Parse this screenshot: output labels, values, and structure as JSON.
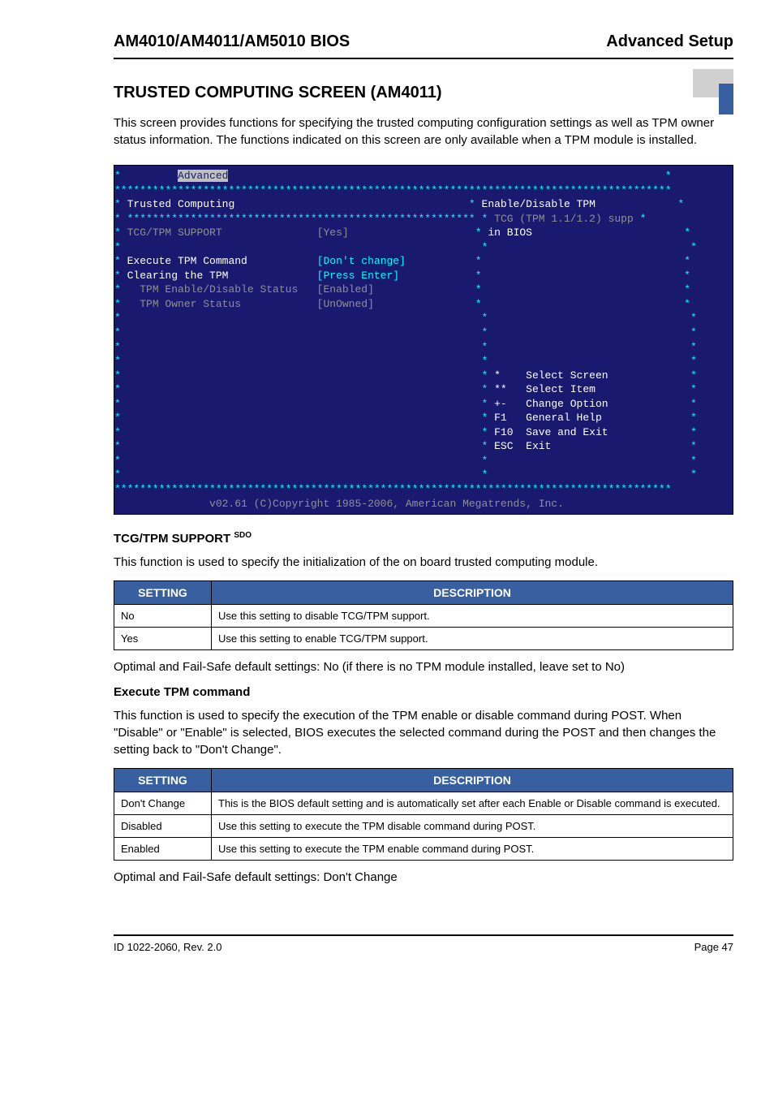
{
  "header": {
    "left": "AM4010/AM4011/AM5010 BIOS",
    "right": "Advanced Setup"
  },
  "section_title": "TRUSTED COMPUTING SCREEN (AM4011)",
  "intro": "This screen provides functions for specifying the trusted computing configuration settings as well as TPM owner status information. The functions indicated on this screen are only available when a TPM module is installed.",
  "bios": {
    "tab": "Advanced",
    "title": "Trusted Computing",
    "items": [
      {
        "label": "TCG/TPM SUPPORT",
        "value": "[Yes]"
      },
      {
        "label": "Execute TPM Command",
        "value": "[Don't change]"
      },
      {
        "label": "Clearing the TPM",
        "value": "[Press Enter]"
      },
      {
        "label": "TPM Enable/Disable Status",
        "value": "[Enabled]"
      },
      {
        "label": "TPM Owner Status",
        "value": "[UnOwned]"
      }
    ],
    "help": [
      "Enable/Disable TPM",
      "TCG (TPM 1.1/1.2) supp",
      "in BIOS"
    ],
    "nav": [
      {
        "key": "*",
        "label": "Select Screen"
      },
      {
        "key": "**",
        "label": "Select Item"
      },
      {
        "key": "+-",
        "label": "Change Option"
      },
      {
        "key": "F1",
        "label": "General Help"
      },
      {
        "key": "F10",
        "label": "Save and Exit"
      },
      {
        "key": "ESC",
        "label": "Exit"
      }
    ],
    "copyright": "v02.61 (C)Copyright 1985-2006, American Megatrends, Inc."
  },
  "tcg_section": {
    "heading": "TCG/TPM SUPPORT",
    "sdo": "SDO",
    "desc": "This function is used to specify the initialization of the on board trusted computing module.",
    "table_headers": {
      "setting": "SETTING",
      "description": "DESCRIPTION"
    },
    "rows": [
      {
        "setting": "No",
        "desc": "Use this setting to disable TCG/TPM support."
      },
      {
        "setting": "Yes",
        "desc": "Use this setting to enable TCG/TPM support."
      }
    ],
    "footnote": "Optimal and Fail-Safe default settings: No (if there is no TPM module installed, leave set to No)"
  },
  "exec_section": {
    "heading": "Execute TPM command",
    "desc": "This function is used to specify the execution of the TPM enable or disable command during POST. When \"Disable\" or \"Enable\" is selected, BIOS executes the selected command during the POST and then changes the setting back to \"Don't Change\".",
    "table_headers": {
      "setting": "SETTING",
      "description": "DESCRIPTION"
    },
    "rows": [
      {
        "setting": "Don't Change",
        "desc": "This is the BIOS default setting and is automatically set after each Enable or Disable command is executed."
      },
      {
        "setting": "Disabled",
        "desc": "Use this setting to execute the TPM disable command during POST."
      },
      {
        "setting": "Enabled",
        "desc": "Use this setting to execute the TPM enable command during POST."
      }
    ],
    "footnote": "Optimal and Fail-Safe default settings: Don't Change"
  },
  "footer": {
    "left": "ID 1022-2060, Rev. 2.0",
    "right": "Page 47"
  }
}
